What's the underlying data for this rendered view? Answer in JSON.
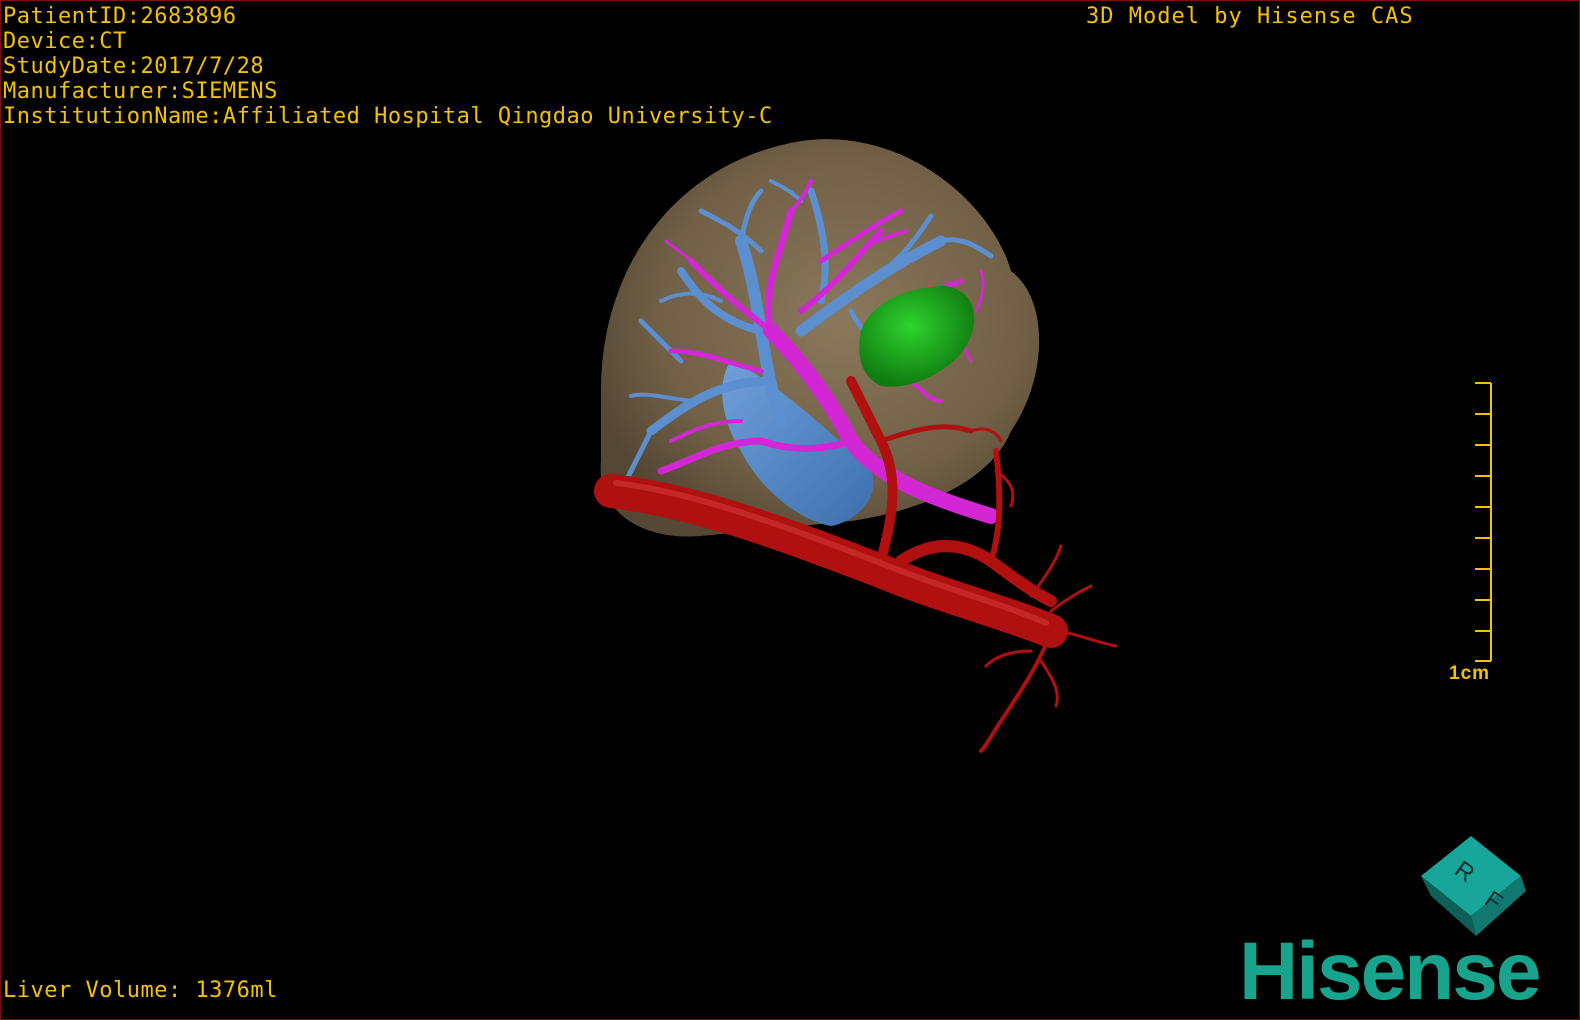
{
  "study_info": {
    "patient_id": "PatientID:2683896",
    "device": "Device:CT",
    "study_date": "StudyDate:2017/7/28",
    "manufacturer": "Manufacturer:SIEMENS",
    "institution": "InstitutionName:Affiliated Hospital Qingdao University-C"
  },
  "credit": "3D Model by Hisense CAS",
  "liver_volume": "Liver Volume: 1376ml",
  "scale_bar": {
    "label": "1cm"
  },
  "orientation_cube": {
    "face_labels": [
      "R",
      "F"
    ]
  },
  "brand": "Hisense",
  "colors": {
    "overlay_text": "#f2c200",
    "liver": "#8a7457",
    "hepatic_vein": "#5b8fcf",
    "portal_vein": "#d327d6",
    "artery": "#b01010",
    "lesion": "#1fa51f",
    "brand": "#17a38c",
    "cube": "#18a59a"
  },
  "icons": [
    "orientation-cube-icon",
    "scale-bar-icon"
  ]
}
